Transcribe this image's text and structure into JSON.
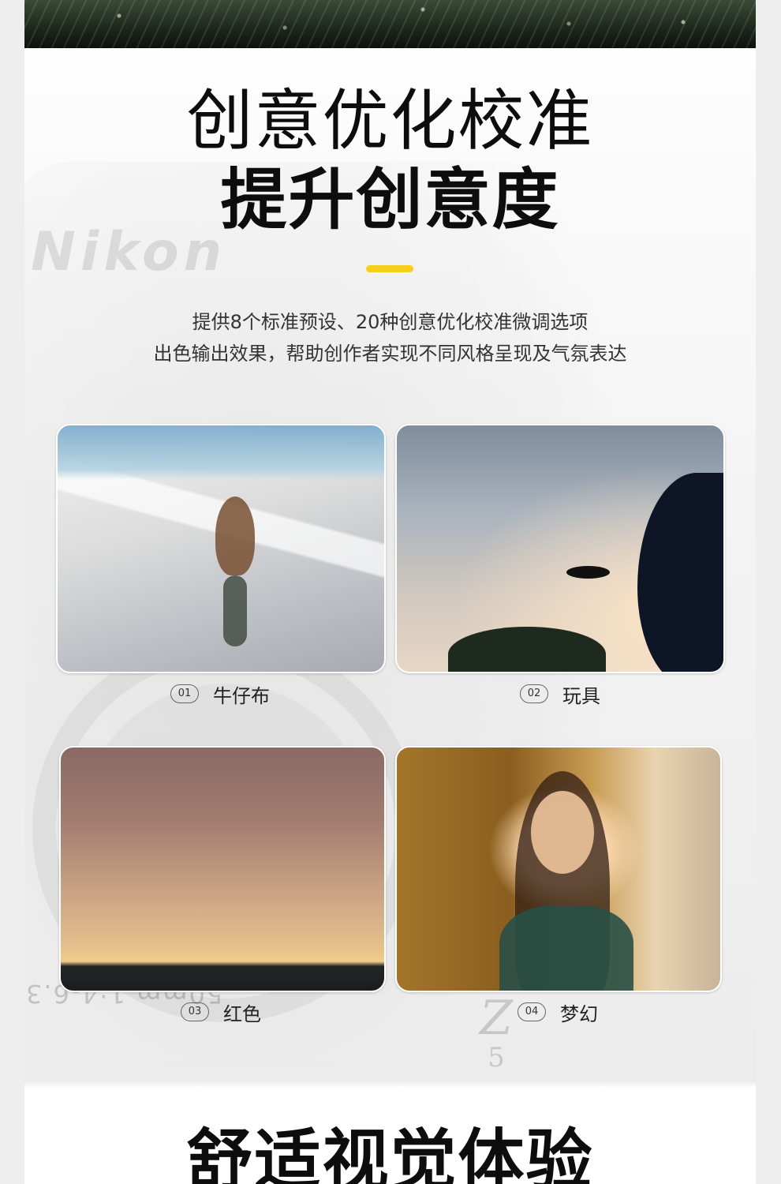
{
  "hero": {
    "title_line1": "创意优化校准",
    "title_line2_prefix": "提升",
    "title_line2_bold": "创意",
    "title_line2_suffix": "度",
    "accent_color": "#f6cf1a"
  },
  "background": {
    "brand_watermark": "Nikon",
    "lens_marking": "50mm 1:4-6.3",
    "model_mark_letter": "Z",
    "model_mark_number": "5"
  },
  "description": {
    "line1": "提供8个标准预设、20种创意优化校准微调选项",
    "line2": "出色输出效果，帮助创作者实现不同风格呈现及气氛表达"
  },
  "presets": [
    {
      "number": "01",
      "label": "牛仔布",
      "image": "cyclist-on-ramp"
    },
    {
      "number": "02",
      "label": "玩具",
      "image": "bird-in-sky"
    },
    {
      "number": "03",
      "label": "红色",
      "image": "sunset-horizon"
    },
    {
      "number": "04",
      "label": "梦幻",
      "image": "woman-portrait"
    }
  ],
  "next_section": {
    "title": "舒适视觉体验"
  }
}
